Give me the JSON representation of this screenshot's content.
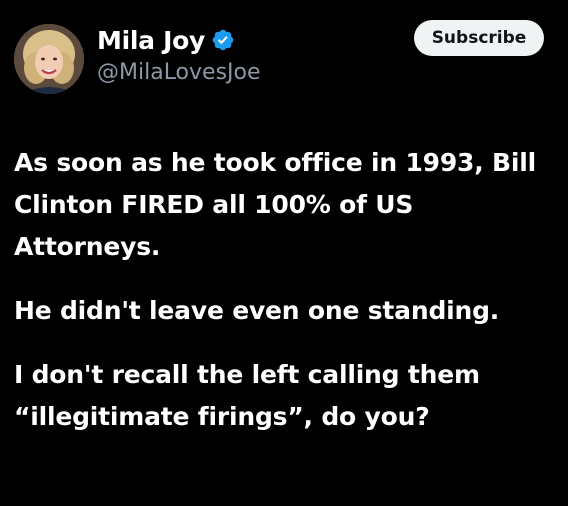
{
  "author": {
    "display_name": "Mila Joy",
    "handle": "@MilaLovesJoe",
    "verified": true,
    "avatar_icon": "profile-photo"
  },
  "actions": {
    "subscribe_label": "Subscribe"
  },
  "post": {
    "paragraphs": [
      "As soon as he took office in 1993, Bill Clinton FIRED all 100% of US Attorneys.",
      "He didn't leave even one standing.",
      "I don't recall the left calling them “illegitimate firings”, do you?"
    ]
  },
  "colors": {
    "background": "#000000",
    "text": "#ffffff",
    "handle": "#8b98a5",
    "verified_badge": "#1d9bf0",
    "subscribe_bg": "#eff3f4"
  }
}
